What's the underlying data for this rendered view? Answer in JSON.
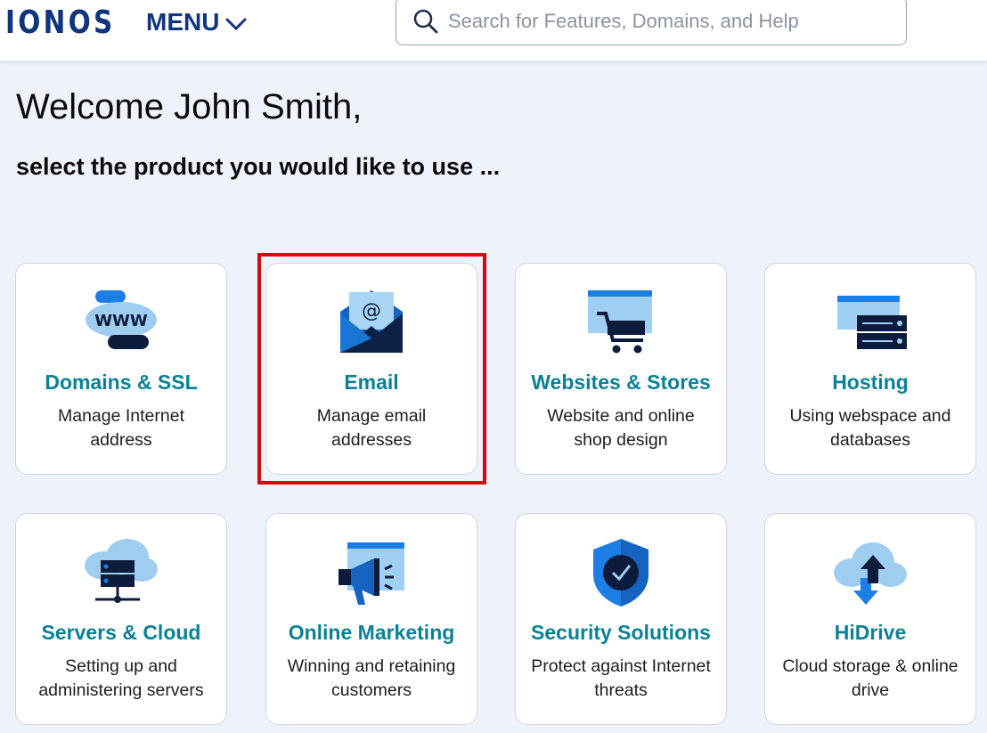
{
  "header": {
    "logo": "IONOS",
    "menu_label": "MENU",
    "search_placeholder": "Search for Features, Domains, and Help"
  },
  "main": {
    "welcome": "Welcome John Smith,",
    "subtitle": "select the product you would like to use ..."
  },
  "products": [
    {
      "title": "Domains & SSL",
      "desc": "Manage Internet address",
      "icon": "www-domain-icon"
    },
    {
      "title": "Email",
      "desc": "Manage email addresses",
      "icon": "email-envelope-icon"
    },
    {
      "title": "Websites & Stores",
      "desc": "Website and online shop design",
      "icon": "shopping-cart-icon"
    },
    {
      "title": "Hosting",
      "desc": "Using webspace and databases",
      "icon": "server-hosting-icon"
    },
    {
      "title": "Servers & Cloud",
      "desc": "Setting up and administering servers",
      "icon": "cloud-server-icon"
    },
    {
      "title": "Online Marketing",
      "desc": "Winning and retaining customers",
      "icon": "megaphone-icon"
    },
    {
      "title": "Security Solutions",
      "desc": "Protect against Internet threats",
      "icon": "shield-check-icon"
    },
    {
      "title": "HiDrive",
      "desc": "Cloud storage & online drive",
      "icon": "cloud-upload-icon"
    }
  ],
  "colors": {
    "brand": "#11347e",
    "accent": "#0a8197",
    "highlight": "#d40a0a"
  }
}
